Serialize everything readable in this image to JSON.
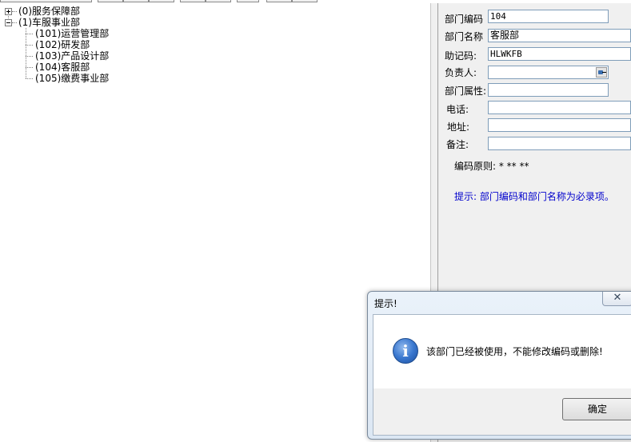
{
  "tree": {
    "nodes": [
      {
        "label": "(0)服务保障部"
      },
      {
        "label": "(1)车服事业部"
      },
      {
        "label": "(101)运营管理部"
      },
      {
        "label": "(102)研发部"
      },
      {
        "label": "(103)产品设计部"
      },
      {
        "label": "(104)客服部"
      },
      {
        "label": "(105)缴费事业部"
      }
    ]
  },
  "form": {
    "dept_code_label": "部门编码",
    "dept_code_value": "104",
    "dept_name_label": "部门名称",
    "dept_name_value": "客服部",
    "mnemonic_label": "助记码:",
    "mnemonic_value": "HLWKFB",
    "manager_label": "负责人:",
    "manager_value": "",
    "attribute_label": "部门属性:",
    "attribute_value": "",
    "phone_label": "电话:",
    "phone_value": "",
    "address_label": "地址:",
    "address_value": "",
    "note_label": "备注:",
    "note_value": "",
    "code_rule_text": "编码原则: * ** **",
    "hint_text": "提示: 部门编码和部门名称为必录项。"
  },
  "dialog": {
    "title": "提示!",
    "message": "该部门已经被使用，不能修改编码或删除!",
    "ok_label": "确定",
    "close_glyph": "✕",
    "info_glyph": "i"
  }
}
